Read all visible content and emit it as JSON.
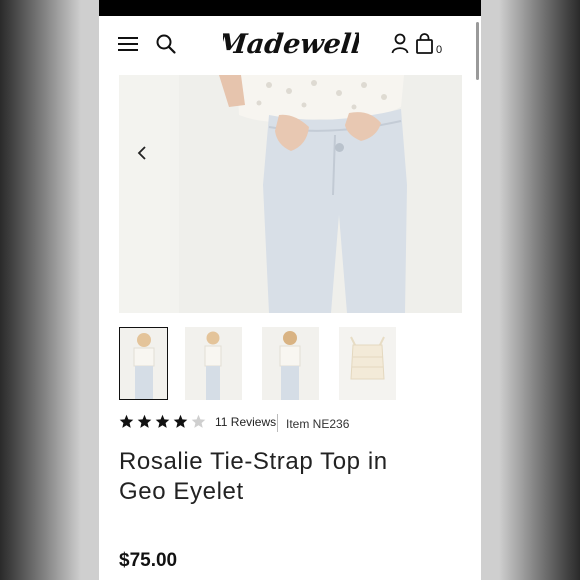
{
  "header": {
    "brand": "Madewell",
    "bag_count": "0"
  },
  "product": {
    "rating": 4,
    "rating_max": 5,
    "reviews": "11 Reviews",
    "item_number": "Item NE236",
    "title_line1": "Rosalie Tie-Strap Top in",
    "title_line2": "Geo Eyelet",
    "price": "$75.00"
  },
  "gallery": {
    "prev_icon": "chevron-left-icon",
    "next_icon": "chevron-right-icon",
    "thumbnail_count": 4,
    "selected_index": 0
  },
  "colors": {
    "star_filled": "#111111",
    "star_empty": "#cfcfcf",
    "jeans": "#d6dde5",
    "top": "#f6f4ef"
  }
}
